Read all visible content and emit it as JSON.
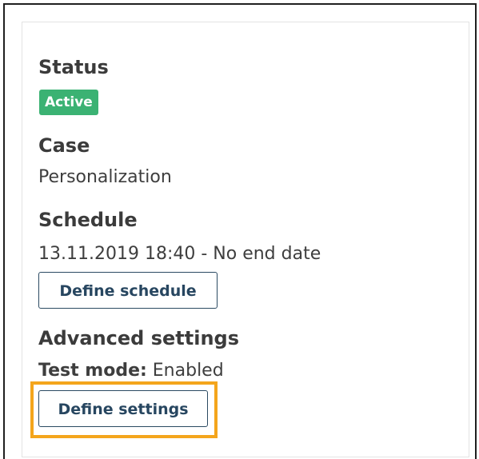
{
  "status": {
    "heading": "Status",
    "badge": "Active",
    "badge_color": "#3bb273"
  },
  "case": {
    "heading": "Case",
    "value": "Personalization"
  },
  "schedule": {
    "heading": "Schedule",
    "value": "13.11.2019 18:40 - No end date",
    "button_label": "Define schedule"
  },
  "advanced": {
    "heading": "Advanced settings",
    "test_mode_label": "Test mode:",
    "test_mode_value": "Enabled",
    "button_label": "Define settings",
    "highlight_color": "#f4a51c"
  }
}
